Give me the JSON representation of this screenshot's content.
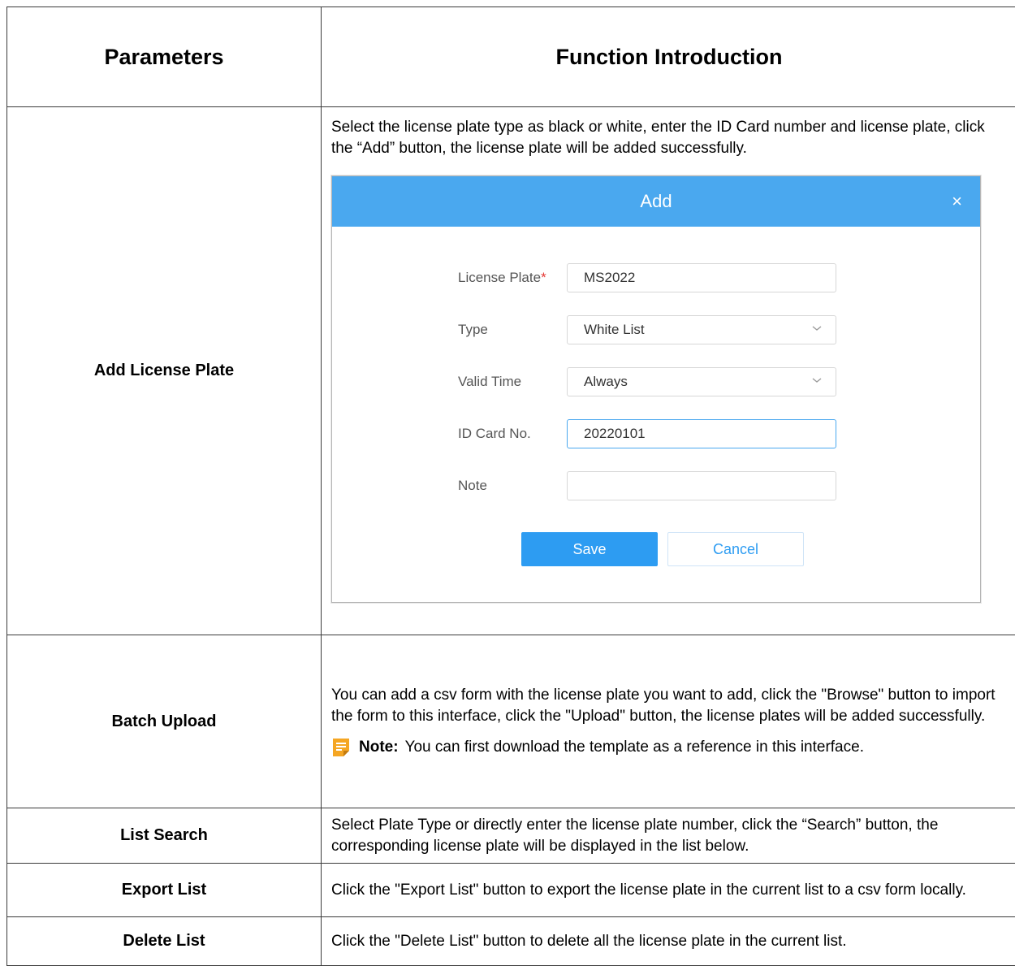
{
  "header": {
    "parameters": "Parameters",
    "function_introduction": "Function Introduction"
  },
  "rows": [
    {
      "name": "Add License Plate",
      "description": "Select the license plate type as black or white, enter the ID Card number and license plate, click the “Add” button, the license plate will be added successfully."
    },
    {
      "name": "Batch Upload",
      "description": "You can add a csv form with the license plate you want to add, click the \"Browse\" button to import the form to this interface, click the \"Upload\" button, the license plates will be added successfully.",
      "note_label": "Note:",
      "note_text": "You can first download the template as a reference in this interface."
    },
    {
      "name": "List Search",
      "description": "Select Plate Type or directly enter the license plate number, click the “Search” button, the corresponding license plate will be displayed in the list below."
    },
    {
      "name": "Export List",
      "description": "Click the \"Export List\" button to export the license plate in the current list to a csv form locally."
    },
    {
      "name": "Delete List",
      "description": "Click the \"Delete List\" button to delete all the license plate in the current list."
    }
  ],
  "dialog": {
    "title": "Add",
    "close_symbol": "×",
    "fields": {
      "license_plate": {
        "label": "License Plate",
        "required_mark": "*",
        "value": "MS2022"
      },
      "type": {
        "label": "Type",
        "value": "White List"
      },
      "valid_time": {
        "label": "Valid Time",
        "value": "Always"
      },
      "id_card": {
        "label": "ID Card No.",
        "value": "20220101"
      },
      "note": {
        "label": "Note",
        "value": ""
      }
    },
    "save_label": "Save",
    "cancel_label": "Cancel",
    "header_color": "#4aa8ef",
    "button_color": "#2d9cf2"
  },
  "icons": {
    "note": "note-icon",
    "close": "close-icon",
    "dropdown": "chevron-down-icon"
  }
}
